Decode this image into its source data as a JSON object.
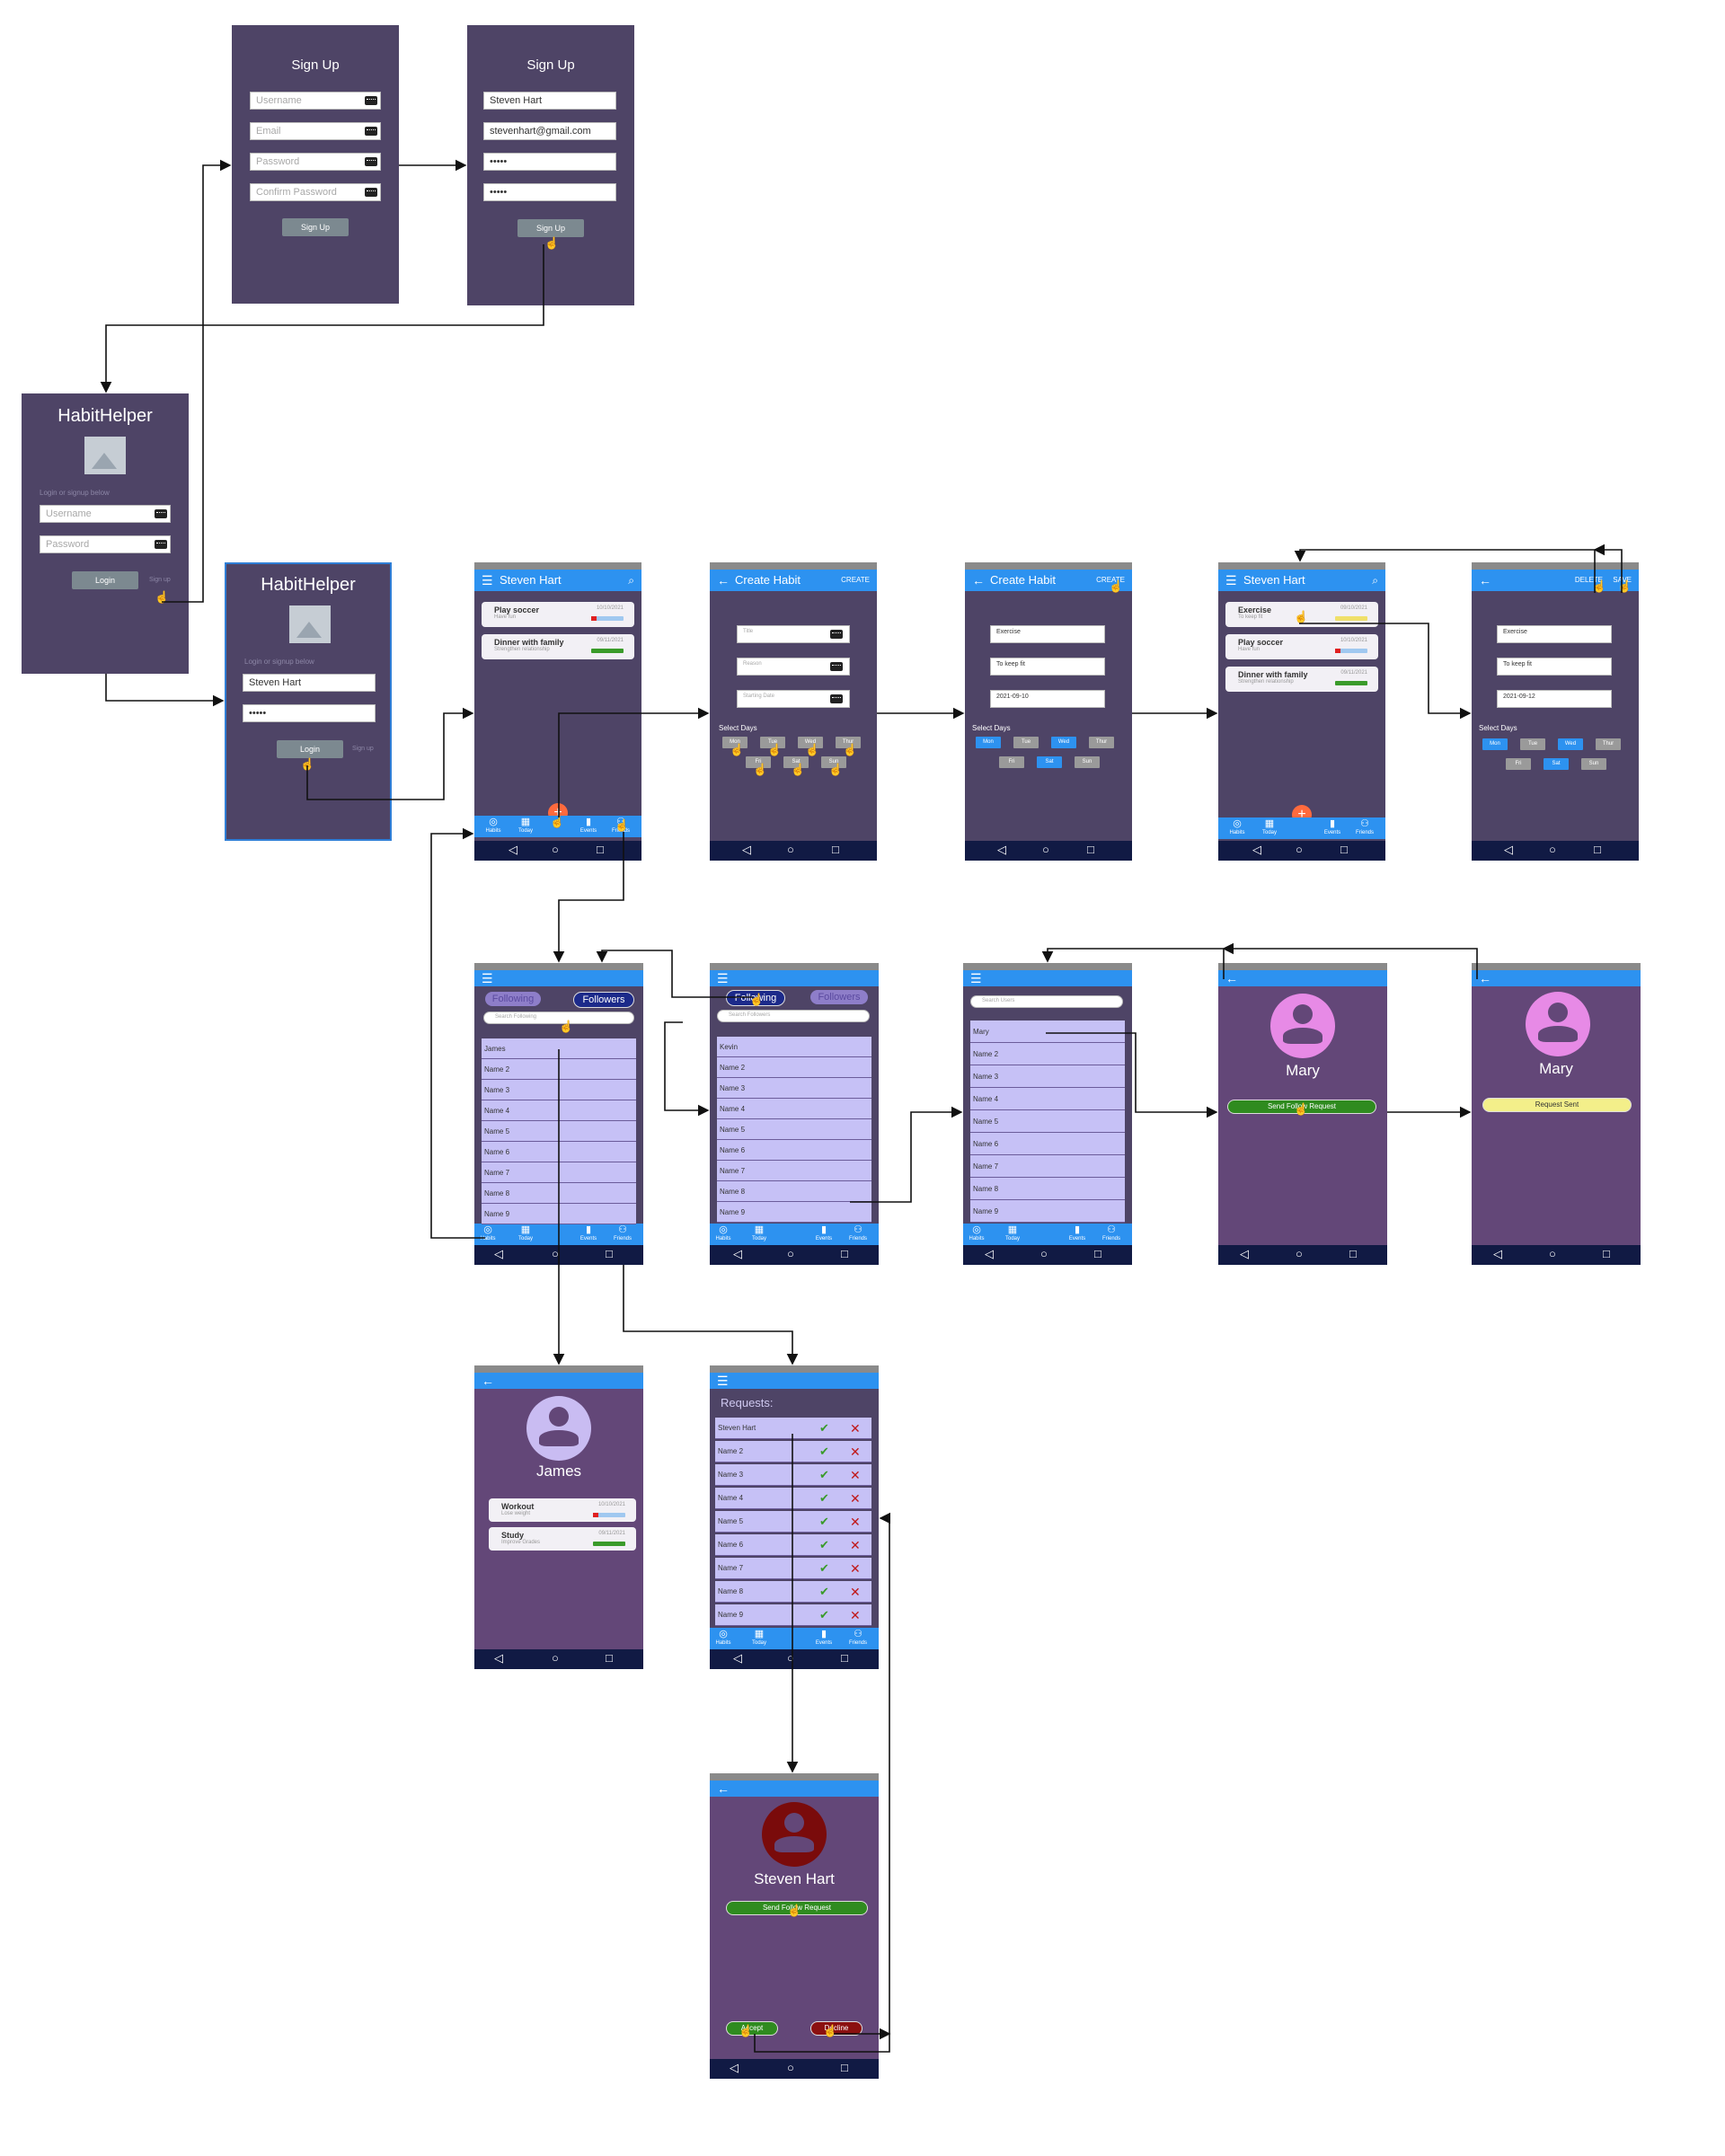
{
  "signup": {
    "title": "Sign Up",
    "username_ph": "Username",
    "email_ph": "Email",
    "password_ph": "Password",
    "confirm_ph": "Confirm Password",
    "button": "Sign Up",
    "filled_username": "Steven Hart",
    "filled_email": "stevenhart@gmail.com",
    "filled_password": "•••••",
    "filled_confirm": "•••••"
  },
  "login": {
    "app_name": "HabitHelper",
    "prompt": "Login or signup below",
    "username_ph": "Username",
    "password_ph": "Password",
    "button": "Login",
    "signup_link": "Sign up",
    "filled_username": "Steven Hart",
    "filled_password": "•••••"
  },
  "home": {
    "title": "Steven Hart",
    "habits": [
      {
        "name": "Play soccer",
        "desc": "Have fun",
        "date": "10/10/2021"
      },
      {
        "name": "Dinner with family",
        "desc": "Strengthen relationship",
        "date": "09/11/2021"
      }
    ],
    "habits_after": [
      {
        "name": "Exercise",
        "desc": "To keep fit",
        "date": "09/10/2021"
      },
      {
        "name": "Play soccer",
        "desc": "Have fun",
        "date": "10/10/2021"
      },
      {
        "name": "Dinner with family",
        "desc": "Strengthen relationship",
        "date": "09/11/2021"
      }
    ]
  },
  "tabs": [
    "Habits",
    "Today",
    "Events",
    "Friends"
  ],
  "create": {
    "title": "Create Habit",
    "action": "CREATE",
    "title_ph": "Title",
    "reason_ph": "Reason",
    "date_ph": "Starting Date",
    "select_days": "Select Days",
    "days": [
      "Mon",
      "Tue",
      "Wed",
      "Thur",
      "Fri",
      "Sat",
      "Sun"
    ],
    "filled_title": "Exercise",
    "filled_reason": "To keep fit",
    "filled_date": "2021-09-10",
    "filled_date2": "2021-09-12"
  },
  "edit": {
    "delete": "DELETE",
    "save": "SAVE"
  },
  "social": {
    "following": "Following",
    "followers": "Followers",
    "search_following": "Search Following",
    "search_followers": "Search Followers",
    "search_users": "Search Users",
    "following_list": [
      "James",
      "Name 2",
      "Name 3",
      "Name 4",
      "Name 5",
      "Name 6",
      "Name 7",
      "Name 8",
      "Name 9"
    ],
    "followers_list": [
      "Kevin",
      "Name 2",
      "Name 3",
      "Name 4",
      "Name 5",
      "Name 6",
      "Name 7",
      "Name 8",
      "Name 9"
    ],
    "users_list": [
      "Mary",
      "Name 2",
      "Name 3",
      "Name 4",
      "Name 5",
      "Name 6",
      "Name 7",
      "Name 8",
      "Name 9"
    ]
  },
  "profile_mary": {
    "name": "Mary",
    "send": "Send Follow Request",
    "sent": "Request Sent"
  },
  "profile_james": {
    "name": "James",
    "habits": [
      {
        "name": "Workout",
        "desc": "Lose weight",
        "date": "10/10/2021"
      },
      {
        "name": "Study",
        "desc": "Improve Grades",
        "date": "09/11/2021"
      }
    ]
  },
  "requests": {
    "title": "Requests:",
    "list": [
      "Steven Hart",
      "Name 2",
      "Name 3",
      "Name 4",
      "Name 5",
      "Name 6",
      "Name 7",
      "Name 8",
      "Name 9"
    ]
  },
  "profile_steven": {
    "name": "Steven Hart",
    "send": "Send Follow Request",
    "accept": "Accept",
    "decline": "Decline"
  },
  "colors": {
    "frame": "#4e4466",
    "frame_profile": "#634778",
    "appbar": "#2d92f0",
    "navbar": "#111a44",
    "list_row": "#c6c1f6",
    "fab": "#ff6a3d",
    "accept": "#2f8b1f",
    "decline": "#8b1010",
    "sent": "#f3ef8a"
  }
}
